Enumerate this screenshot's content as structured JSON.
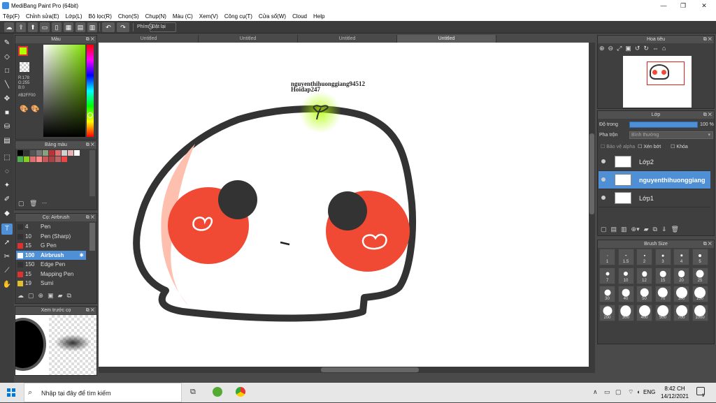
{
  "window": {
    "title": "MediBang Paint Pro (64bit)",
    "controls": [
      "—",
      "❐",
      "✕"
    ]
  },
  "menu": [
    "Tệp(F)",
    "Chỉnh sửa(E)",
    "Lớp(L)",
    "Bộ lọc(R)",
    "Chọn(S)",
    "Chụp(N)",
    "Màu (C)",
    "Xem(V)",
    "Công cụ(T)",
    "Cửa sổ(W)",
    "Cloud",
    "Help"
  ],
  "toolbar": {
    "phim_label": "Phím",
    "reset_label": "Đặt lại"
  },
  "doc_tabs": [
    "Untitled",
    "Untitled",
    "Untitled",
    "Untitled"
  ],
  "color_panel": {
    "title": "Màu",
    "r": "R:178",
    "g": "G:255",
    "b": "B:0",
    "hex": "#B2FF00",
    "fg_color": "#b2ff00"
  },
  "palette": {
    "title": "Bảng màu",
    "dash": "---",
    "colors": [
      "#000000",
      "#333333",
      "#555555",
      "#777777",
      "#8aa17d",
      "#bb3333",
      "#e06e6e",
      "#d0d0d0",
      "#e8b0b0",
      "#ffffff",
      "#4caf50",
      "#88cc22",
      "#e07070",
      "#ff8888",
      "#cc5555",
      "#aa4444",
      "#bb6666",
      "#ee4444"
    ]
  },
  "brush_panel": {
    "title": "Cọ: Airbrush",
    "items": [
      {
        "size": "4",
        "name": "Pen",
        "color": "#333333"
      },
      {
        "size": "10",
        "name": "Pen (Sharp)",
        "color": "#333333"
      },
      {
        "size": "15",
        "name": "G Pen",
        "color": "#e03030"
      },
      {
        "size": "100",
        "name": "Airbrush",
        "color": "#ffffff",
        "selected": true
      },
      {
        "size": "150",
        "name": "Edge Pen",
        "color": "#333333"
      },
      {
        "size": "15",
        "name": "Mapping Pen",
        "color": "#e03030"
      },
      {
        "size": "19",
        "name": "Sumi",
        "color": "#e0c030"
      }
    ]
  },
  "preview_panel": {
    "title": "Xem trước cọ"
  },
  "navigator": {
    "title": "Hoa tiêu"
  },
  "layers": {
    "title": "Lớp",
    "opacity_label": "Độ trong",
    "opacity_value": "100 %",
    "blend_label": "Pha trộn",
    "blend_value": "Bình thường",
    "protect_alpha": "Bảo vệ alpha",
    "clipping": "Xén bớt",
    "lock": "Khóa",
    "items": [
      {
        "name": "Lớp2",
        "selected": false
      },
      {
        "name": "nguyenthihuonggiang",
        "selected": true
      },
      {
        "name": "Lớp1",
        "selected": false
      }
    ]
  },
  "brush_size": {
    "title": "Brush Size",
    "values": [
      "1",
      "1.5",
      "2",
      "3",
      "4",
      "5",
      "7",
      "10",
      "12",
      "15",
      "20",
      "25",
      "30",
      "40",
      "50",
      "70",
      "100",
      "150",
      "200",
      "300",
      "400",
      "500",
      "700",
      "1000"
    ]
  },
  "canvas": {
    "watermark_line1": "nguyenthihuonggiang94512",
    "watermark_line2": "Hoidap247"
  },
  "taskbar": {
    "search_placeholder": "Nhập tại đây để tìm kiếm",
    "lang": "ENG",
    "time": "8:42 CH",
    "date": "14/12/2021",
    "notif_count": "9"
  }
}
